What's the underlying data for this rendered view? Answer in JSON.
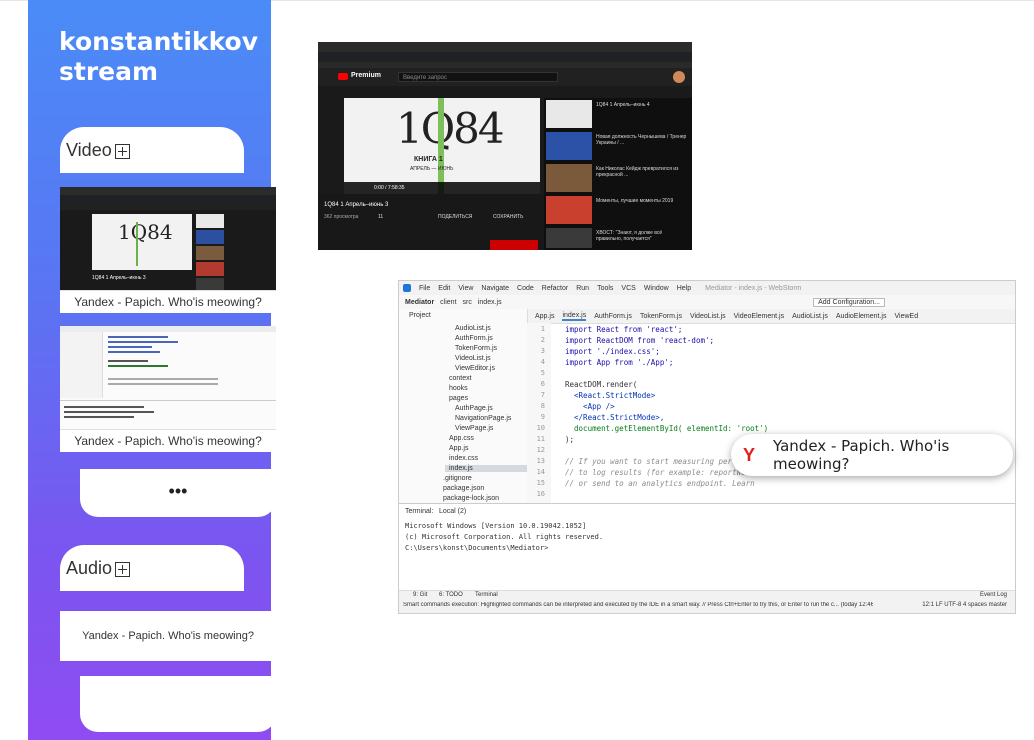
{
  "sidebar": {
    "title_line1": "konstantikkov",
    "title_line2": "stream",
    "video_label": "Video",
    "audio_label": "Audio",
    "items": [
      {
        "caption": "Yandex - Papich. Who'is meowing?"
      },
      {
        "caption": "Yandex - Papich. Who'is meowing?"
      }
    ],
    "more_label": "•••",
    "audio_items": [
      {
        "caption": "Yandex - Papich. Who'is meowing?"
      }
    ]
  },
  "youtube": {
    "logo": "Premium",
    "search_placeholder": "Введите запрос",
    "book_title": "1Q84",
    "book_sub": "КНИГА 1",
    "book_sub2": "АПРЕЛЬ — ИЮНЬ",
    "video_title": "1Q84 1 Апрель–июнь 3",
    "views": "362 просмотра",
    "likes": "11",
    "share": "ПОДЕЛИТЬСЯ",
    "save": "СОХРАНИТЬ",
    "time": "0:00 / 7:58:35",
    "side_items": [
      "1Q84 1 Апрель–июнь 4",
      "Новая должность Чернышева / Тренер Украины / ...",
      "Как Николас Кейдж превратился из прекрасной ...",
      "Моменты, лучшие моменты 2019",
      "ХВОСТ: \"Знают, я долже всё правильно, получается\""
    ]
  },
  "ide": {
    "menu": [
      "File",
      "Edit",
      "View",
      "Navigate",
      "Code",
      "Refactor",
      "Run",
      "Tools",
      "VCS",
      "Window",
      "Help"
    ],
    "window_title": "Mediator - index.js - WebStorm",
    "crumbs": [
      "Mediator",
      "client",
      "src",
      "index.js"
    ],
    "add_config": "Add Configuration...",
    "tabs": [
      "App.js",
      "index.js",
      "AuthForm.js",
      "TokenForm.js",
      "VideoList.js",
      "VideoElement.js",
      "AudioList.js",
      "AudioElement.js",
      "ViewEd"
    ],
    "project_label": "Project",
    "tree": [
      "AudioList.js",
      "AuthForm.js",
      "TokenForm.js",
      "VideoList.js",
      "ViewEditor.js",
      "context",
      "hooks",
      "pages",
      "AuthPage.js",
      "NavigationPage.js",
      "ViewPage.js",
      "App.css",
      "App.js",
      "index.css",
      "index.js",
      ".gitignore",
      "package.json",
      "package-lock.json"
    ],
    "line_numbers": [
      "1",
      "2",
      "3",
      "4",
      "5",
      "6",
      "7",
      "8",
      "9",
      "10",
      "11",
      "12",
      "13",
      "14",
      "15",
      "16"
    ],
    "code": [
      "import React from 'react';",
      "import ReactDOM from 'react-dom';",
      "import './index.css';",
      "import App from './App';",
      "",
      "ReactDOM.render(",
      "  <React.StrictMode>",
      "    <App />",
      "  </React.StrictMode>,",
      "  document.getElementById( elementId: 'root')",
      ");",
      "",
      "// If you want to start measuring performa",
      "// to log results (for example: reportWebV",
      "// or send to an analytics endpoint. Learn",
      ""
    ],
    "terminal_label": "Terminal:",
    "terminal_tab": "Local (2)",
    "terminal_lines": [
      "Microsoft Windows [Version 10.0.19042.1052]",
      "(c) Microsoft Corporation. All rights reserved.",
      "C:\\Users\\konst\\Documents\\Mediator>"
    ],
    "bottom_tabs": [
      "9: Git",
      "6: TODO",
      "Terminal"
    ],
    "event_log": "Event Log",
    "status_text": "Smart commands execution: Highlighted commands can be interpreted and executed by the IDE in a smart way. // Press Ctrl+Enter to try this, or Enter to run the c... (today 12:46 PM",
    "status_right": "12:1  LF  UTF-8  4 spaces  master"
  },
  "popup": {
    "text": "Yandex - Papich. Who'is meowing?"
  },
  "colors": {
    "gradient_top": "#4a8cf7",
    "gradient_bottom": "#8f4cf2",
    "yandex_red": "#e31c1c"
  }
}
